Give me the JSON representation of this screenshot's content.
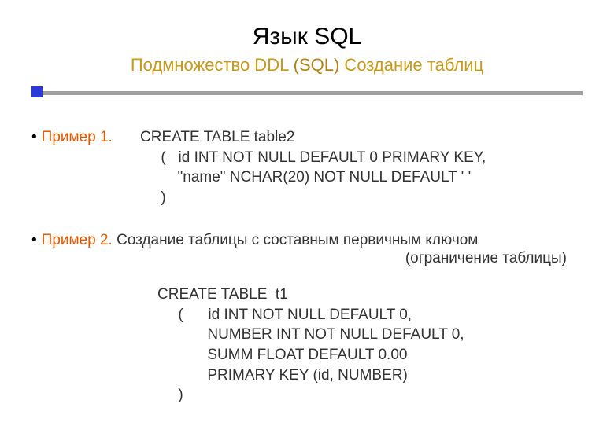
{
  "title": "Язык SQL",
  "subtitle_prefix": "Подмножество DDL ",
  "subtitle_paren": "(SQL)",
  "subtitle_suffix": " Создание таблиц",
  "example1": {
    "label": "Пример 1.",
    "code": "CREATE TABLE table2\n     (   id INT NOT NULL DEFAULT 0 PRIMARY KEY,\n         \"name\" NCHAR(20) NOT NULL DEFAULT ' '\n     )"
  },
  "example2": {
    "label": "Пример 2.",
    "desc": " Создание таблицы с составным первичным ключом",
    "note": "(ограничение таблицы)",
    "code": "CREATE TABLE  t1\n     (      id INT NOT NULL DEFAULT 0,\n            NUMBER INT NOT NULL DEFAULT 0,\n            SUMM FLOAT DEFAULT 0.00\n            PRIMARY KEY (id, NUMBER)\n     )"
  }
}
